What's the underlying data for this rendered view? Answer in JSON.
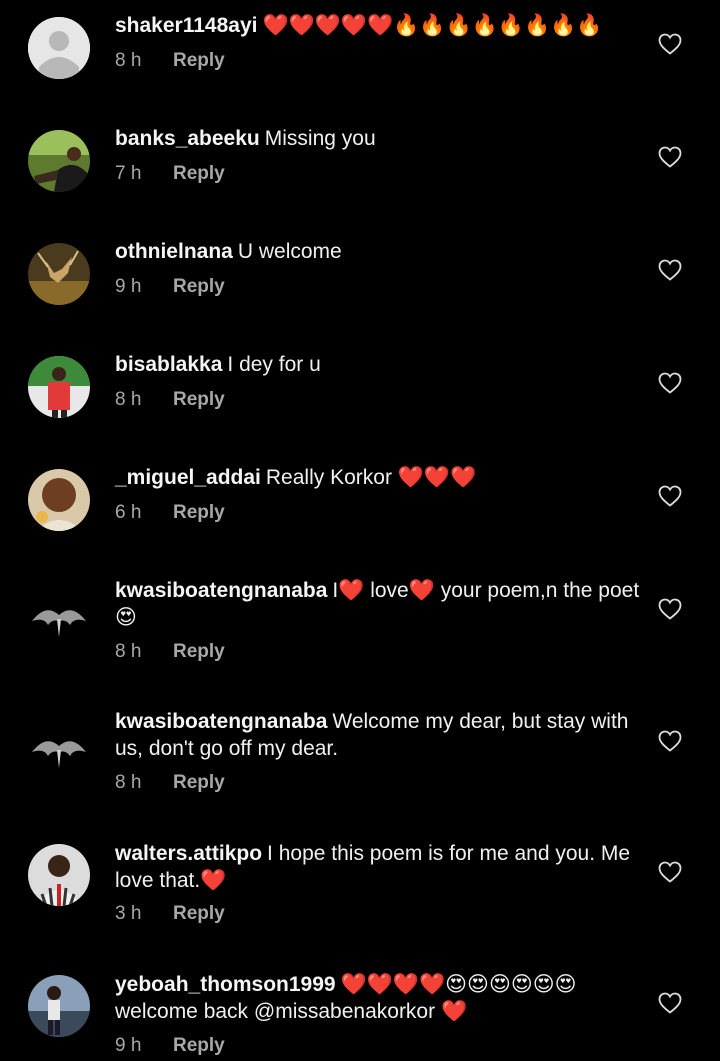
{
  "comments": [
    {
      "username": "shaker1148ayi",
      "text": "❤️❤️❤️❤️❤️🔥🔥🔥🔥🔥🔥🔥🔥",
      "time": "8 h",
      "reply": "Reply"
    },
    {
      "username": "banks_abeeku",
      "text": "Missing you",
      "time": "7 h",
      "reply": "Reply"
    },
    {
      "username": "othnielnana",
      "text": "U welcome",
      "time": "9 h",
      "reply": "Reply"
    },
    {
      "username": "bisablakka",
      "text": "I dey for u",
      "time": "8 h",
      "reply": "Reply"
    },
    {
      "username": "_miguel_addai",
      "text": "Really Korkor ❤️❤️❤️",
      "time": "6 h",
      "reply": "Reply"
    },
    {
      "username": "kwasiboatengnanaba",
      "text": "I❤️ love❤️ your poem,n the poet😍",
      "time": "8 h",
      "reply": "Reply"
    },
    {
      "username": "kwasiboatengnanaba",
      "text": "Welcome my dear, but stay with us, don't go off my dear.",
      "time": "8 h",
      "reply": "Reply"
    },
    {
      "username": "walters.attikpo",
      "text": "I hope this poem is for me and you. Me love that.❤️",
      "time": "3 h",
      "reply": "Reply"
    },
    {
      "username": "yeboah_thomson1999",
      "text": "❤️❤️❤️❤️😍😍😍😍😍😍 welcome back @missabenakorkor ❤️",
      "time": "9 h",
      "reply": "Reply"
    }
  ],
  "colors": {
    "background": "#000000",
    "text": "#f2f2f2",
    "meta": "#a8a8a8",
    "heart_emoji": "#ff2a3c"
  },
  "icons": {
    "like": "heart-outline-icon"
  }
}
